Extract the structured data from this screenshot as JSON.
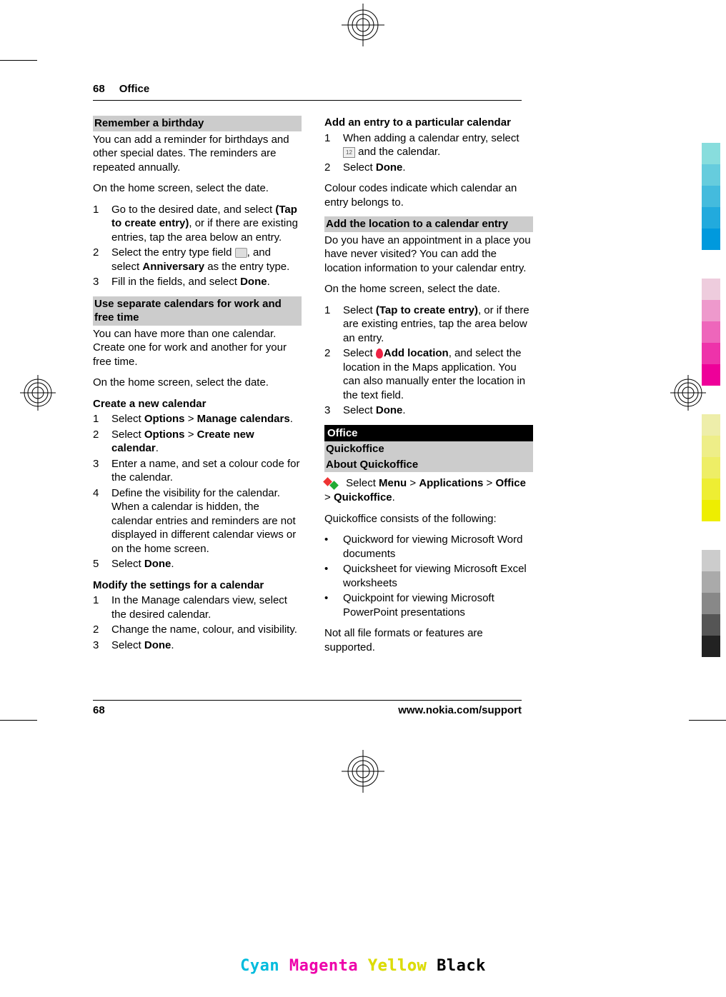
{
  "header": {
    "page": "68",
    "section": "Office"
  },
  "s1": {
    "title": "Remember a birthday",
    "intro": "You can add a reminder for birthdays and other special dates. The reminders are repeated annually.",
    "prompt": "On the home screen, select the date.",
    "step1a": "Go to the desired date, and select ",
    "step1b": "(Tap to create entry)",
    "step1c": ", or if there are existing entries, tap the area below an entry.",
    "step2a": "Select the entry type field ",
    "step2b": ", and select ",
    "step2c": "Anniversary",
    "step2d": " as the entry type.",
    "step3a": "Fill in the fields, and select ",
    "step3b": "Done",
    "step3c": "."
  },
  "s2": {
    "title": "Use separate calendars for work and free time",
    "intro": "You can have more than one calendar. Create one for work and another for your free time.",
    "prompt": "On the home screen, select the date."
  },
  "s3": {
    "subtitle": "Create a new calendar",
    "step1a": "Select ",
    "step1b": "Options",
    "step1c": " > ",
    "step1d": "Manage calendars",
    "step1e": ".",
    "step2a": "Select ",
    "step2b": "Options",
    "step2c": " > ",
    "step2d": "Create new calendar",
    "step2e": ".",
    "step3": "Enter a name, and set a colour code for the calendar.",
    "step4": "Define the visibility for the calendar. When a calendar is hidden, the calendar entries and reminders are not displayed in different calendar views or on the home screen.",
    "step5a": "Select ",
    "step5b": "Done",
    "step5c": "."
  },
  "s4": {
    "subtitle": "Modify the settings for a calendar",
    "step1": "In the Manage calendars view, select the desired calendar.",
    "step2": "Change the name, colour, and visibility.",
    "step3a": "Select ",
    "step3b": "Done",
    "step3c": "."
  },
  "s5": {
    "subtitle": "Add an entry to a particular calendar",
    "step1a": "When adding a calendar entry, select ",
    "step1b": " and the calendar.",
    "step2a": "Select ",
    "step2b": "Done",
    "step2c": ".",
    "note": "Colour codes indicate which calendar an entry belongs to."
  },
  "s6": {
    "title": "Add the location to a calendar entry",
    "intro": "Do you have an appointment in a place you have never visited? You can add the location information to your calendar entry.",
    "prompt": "On the home screen, select the date.",
    "step1a": "Select ",
    "step1b": "(Tap to create entry)",
    "step1c": ", or if there are existing entries, tap the area below an entry.",
    "step2a": "Select ",
    "step2b": "Add location",
    "step2c": ", and select the location in the Maps application. You can also manually enter the location in the text field.",
    "step3a": "Select ",
    "step3b": "Done",
    "step3c": "."
  },
  "office": {
    "heading": "Office",
    "sub1": "Quickoffice",
    "sub2": "About Quickoffice",
    "nav1": " Select ",
    "nav2": "Menu",
    "nav3": " > ",
    "nav4": "Applications",
    "nav5": " > ",
    "nav6": "Office",
    "nav7": " > ",
    "nav8": "Quickoffice",
    "nav9": ".",
    "lead": "Quickoffice consists of the following:",
    "b1": "Quickword for viewing Microsoft Word documents",
    "b2": "Quicksheet for viewing Microsoft Excel worksheets",
    "b3": "Quickpoint for viewing Microsoft PowerPoint presentations",
    "note": "Not all file formats or features are supported."
  },
  "footer": {
    "page": "68",
    "url": "www.nokia.com/support"
  },
  "cmyk": {
    "c": "Cyan",
    "m": "Magenta",
    "y": "Yellow",
    "k": "Black"
  },
  "icons": {
    "entry_type": "⬚",
    "cal12": "12"
  }
}
